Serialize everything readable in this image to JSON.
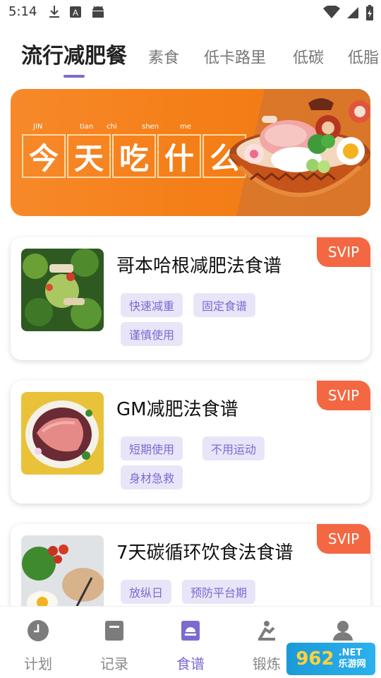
{
  "status_bar": {
    "time": "5:14",
    "icons_left": [
      "download-icon",
      "text-a-icon",
      "android-icon"
    ],
    "icons_right": [
      "wifi-icon",
      "signal-icon",
      "battery-icon"
    ]
  },
  "tabs": [
    {
      "label": "流行减肥餐",
      "active": true
    },
    {
      "label": "素食"
    },
    {
      "label": "低卡路里"
    },
    {
      "label": "低碳"
    },
    {
      "label": "低脂"
    }
  ],
  "banner": {
    "pinyin": [
      "JIN",
      "tian",
      "chi",
      "shen",
      "me"
    ],
    "title_chars": [
      "今",
      "天",
      "吃",
      "什",
      "么"
    ]
  },
  "cards": [
    {
      "title": "哥本哈根减肥法食谱",
      "badge": "SVIP",
      "tags": [
        "快速减重",
        "固定食谱",
        "谨慎使用"
      ]
    },
    {
      "title": "GM减肥法食谱",
      "badge": "SVIP",
      "tags": [
        "短期使用",
        "不用运动",
        "身材急救"
      ]
    },
    {
      "title": "7天碳循环饮食法食谱",
      "badge": "SVIP",
      "tags": [
        "放纵日",
        "预防平台期"
      ]
    }
  ],
  "bottom_nav": [
    {
      "label": "计划",
      "icon": "clock-icon"
    },
    {
      "label": "记录",
      "icon": "notebook-icon"
    },
    {
      "label": "食谱",
      "icon": "recipe-book-icon",
      "active": true
    },
    {
      "label": "锻炼",
      "icon": "exercise-icon"
    },
    {
      "label": "",
      "icon": "profile-icon"
    }
  ],
  "watermark": {
    "number": "962",
    "suffix": ".NET",
    "site": "乐游网"
  },
  "colors": {
    "accent": "#7a6bd1",
    "svip": "#f36843",
    "banner": "#f47e17",
    "tag_bg": "#e8e5f8"
  }
}
